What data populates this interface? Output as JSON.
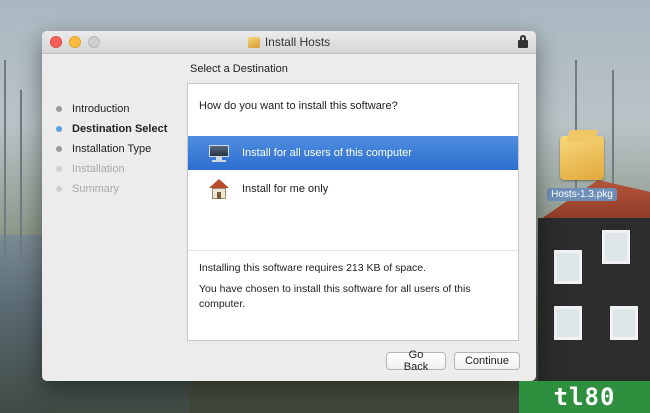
{
  "window": {
    "title": "Install Hosts"
  },
  "heading": "Select a Destination",
  "sidebar": {
    "steps": [
      {
        "label": "Introduction",
        "state": "done"
      },
      {
        "label": "Destination Select",
        "state": "active"
      },
      {
        "label": "Installation Type",
        "state": "done"
      },
      {
        "label": "Installation",
        "state": "disabled"
      },
      {
        "label": "Summary",
        "state": "disabled"
      }
    ]
  },
  "panel": {
    "question": "How do you want to install this software?",
    "options": [
      {
        "label": "Install for all users of this computer",
        "icon": "monitor-icon",
        "selected": true
      },
      {
        "label": "Install for me only",
        "icon": "home-icon",
        "selected": false
      }
    ],
    "space_required": "Installing this software requires 213 KB of space.",
    "chosen_message": "You have chosen to install this software for all users of this computer."
  },
  "buttons": {
    "back": "Go Back",
    "continue": "Continue"
  },
  "desktop": {
    "file_label": "Hosts-1.3.pkg"
  },
  "watermark": "tl80",
  "colors": {
    "selection": "#2e6ed0",
    "active_step_dot": "#5aa1e3",
    "watermark_bg": "#2e8f3e"
  }
}
